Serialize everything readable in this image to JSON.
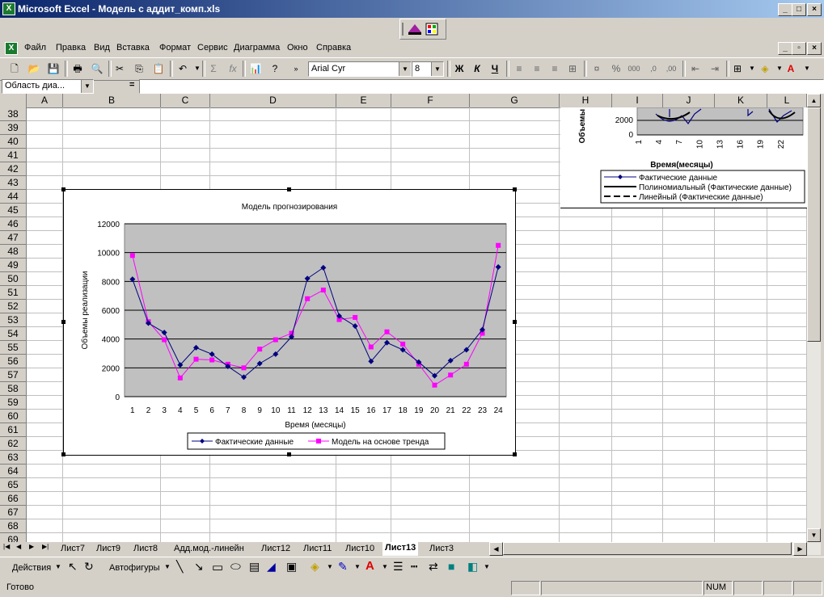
{
  "window": {
    "title": "Microsoft Excel - Модель с аддит_комп.xls",
    "app_icon": "excel-icon"
  },
  "menu": [
    "Файл",
    "Правка",
    "Вид",
    "Вставка",
    "Формат",
    "Сервис",
    "Диаграмма",
    "Окно",
    "Справка"
  ],
  "toolbar": {
    "font_name": "Arial Cyr",
    "font_size": "8",
    "bold": "Ж",
    "italic": "К",
    "underline": "Ч"
  },
  "formula_bar": {
    "name_box": "Область диа...",
    "equals": "="
  },
  "columns": [
    "A",
    "B",
    "C",
    "D",
    "E",
    "F",
    "G",
    "H",
    "I",
    "J",
    "K",
    "L"
  ],
  "rows": [
    "38",
    "39",
    "40",
    "41",
    "42",
    "43",
    "44",
    "45",
    "46",
    "47",
    "48",
    "49",
    "50",
    "51",
    "52",
    "53",
    "54",
    "55",
    "56",
    "57",
    "58",
    "59",
    "60",
    "61",
    "62",
    "63",
    "64",
    "65",
    "66",
    "67",
    "68",
    "69"
  ],
  "sheet_tabs": [
    "Лист7",
    "Лист9",
    "Лист8",
    "Адд.мод.-линейн",
    "Лист12",
    "Лист11",
    "Лист10",
    "Лист13",
    "Лист3"
  ],
  "active_tab": "Лист13",
  "drawing_toolbar": {
    "actions": "Действия",
    "autoshapes": "Автофигуры"
  },
  "status": {
    "text": "Готово",
    "num": "NUM"
  },
  "chart_data": [
    {
      "type": "line",
      "title": "Модель прогнозирования",
      "xlabel": "Время (месяцы)",
      "ylabel": "Объемы реализации",
      "ylim": [
        0,
        12000
      ],
      "yticks": [
        "0",
        "2000",
        "4000",
        "6000",
        "8000",
        "10000",
        "12000"
      ],
      "x": [
        1,
        2,
        3,
        4,
        5,
        6,
        7,
        8,
        9,
        10,
        11,
        12,
        13,
        14,
        15,
        16,
        17,
        18,
        19,
        20,
        21,
        22,
        23,
        24
      ],
      "series": [
        {
          "name": "Фактические данные",
          "color": "#000080",
          "marker": "diamond",
          "values": [
            8150,
            5100,
            4450,
            2200,
            3400,
            2950,
            2100,
            1350,
            2300,
            2950,
            4150,
            8200,
            8950,
            5600,
            4900,
            2450,
            3750,
            3250,
            2400,
            1450,
            2500,
            3250,
            4650,
            9000
          ]
        },
        {
          "name": "Модель на основе тренда",
          "color": "#ff00ff",
          "marker": "square",
          "values": [
            9800,
            5200,
            3950,
            1300,
            2600,
            2550,
            2250,
            2000,
            3300,
            3950,
            4400,
            6800,
            7400,
            5350,
            5500,
            3450,
            4500,
            3650,
            2250,
            800,
            1500,
            2250,
            4400,
            10500
          ]
        }
      ],
      "grid": true,
      "legend": "bottom"
    },
    {
      "type": "line",
      "partial": true,
      "ylabel": "Объемы",
      "xlabel": "Время(месяцы)",
      "yticks": [
        "0",
        "2000"
      ],
      "xticks": [
        "1",
        "4",
        "7",
        "10",
        "13",
        "16",
        "19",
        "22"
      ],
      "legend_entries": [
        "Фактические данные",
        "Полиномиальный (Фактические данные)",
        "Линейный (Фактические данные)"
      ]
    }
  ]
}
